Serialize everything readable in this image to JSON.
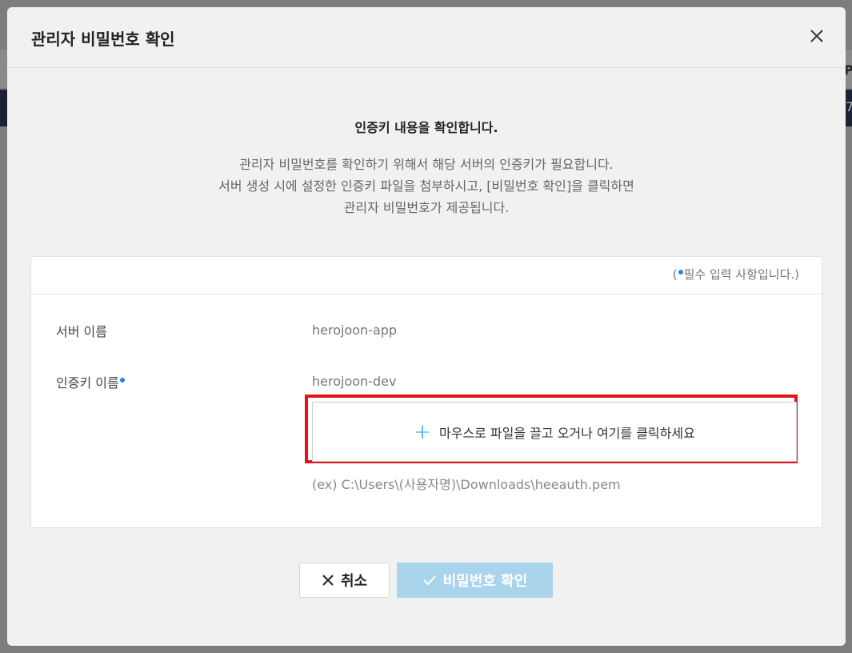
{
  "background": {
    "edge_text_1": "P",
    "edge_text_2": "7"
  },
  "modal": {
    "title": "관리자 비밀번호 확인",
    "close_icon": "close-icon"
  },
  "intro": {
    "title": "인증키 내용을 확인합니다.",
    "lines": [
      "관리자 비밀번호를 확인하기 위해서 해당 서버의 인증키가 필요합니다.",
      "서버 생성 시에 설정한 인증키 파일을 첨부하시고, [비밀번호 확인]을 클릭하면",
      "관리자 비밀번호가 제공됩니다."
    ]
  },
  "form": {
    "required_note_prefix": "(",
    "required_note_text": "필수 입력 사항입니다.)",
    "server_name_label": "서버 이름",
    "server_name_value": "herojoon-app",
    "auth_key_label": "인증키 이름",
    "auth_key_value": "herojoon-dev",
    "upload_plus": "+",
    "upload_text": "마우스로 파일을 끌고 오거나 여기를 클릭하세요",
    "path_hint": "(ex) C:\\Users\\(사용자명)\\Downloads\\heeauth.pem"
  },
  "buttons": {
    "cancel_label": "취소",
    "confirm_label": "비밀번호 확인"
  },
  "colors": {
    "accent": "#1e88e5",
    "highlight": "#e1141c",
    "confirm_disabled": "#a9d4ec"
  }
}
